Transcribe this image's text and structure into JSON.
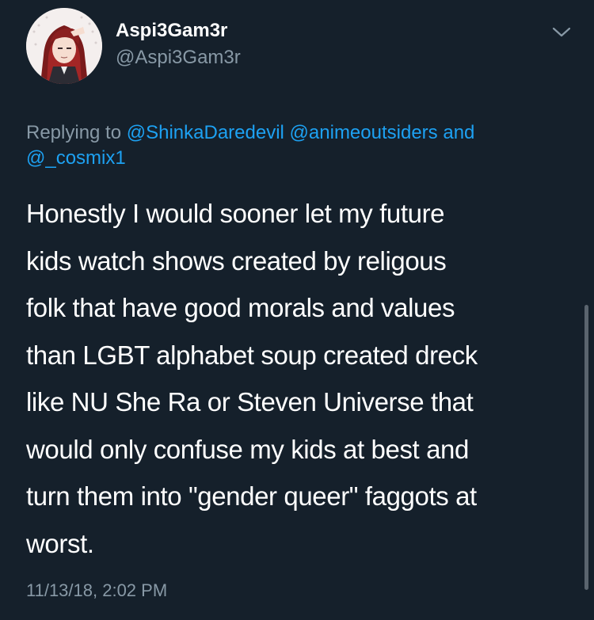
{
  "colors": {
    "background": "#15202b",
    "text_primary": "#ffffff",
    "text_secondary": "#8899a6",
    "accent_link": "#1da1f2"
  },
  "author": {
    "display_name": "Aspi3Gam3r",
    "handle": "@Aspi3Gam3r",
    "avatar_icon": "anime-character-avatar"
  },
  "menu": {
    "icon": "chevron-down-icon"
  },
  "reply": {
    "prefix": "Replying to",
    "mentions": [
      "@ShinkaDaredevil",
      "@animeoutsiders",
      "@_cosmix1"
    ],
    "conjunction": "and"
  },
  "tweet": {
    "lines": [
      "Honestly I would sooner let my future",
      "kids watch shows created by religous",
      "folk that have good morals and values",
      "than LGBT alphabet soup created dreck",
      "like NU She Ra or Steven Universe that",
      "would only confuse my kids at best and",
      "turn them into \"gender queer\" faggots at",
      "worst."
    ],
    "timestamp": "11/13/18, 2:02 PM"
  }
}
